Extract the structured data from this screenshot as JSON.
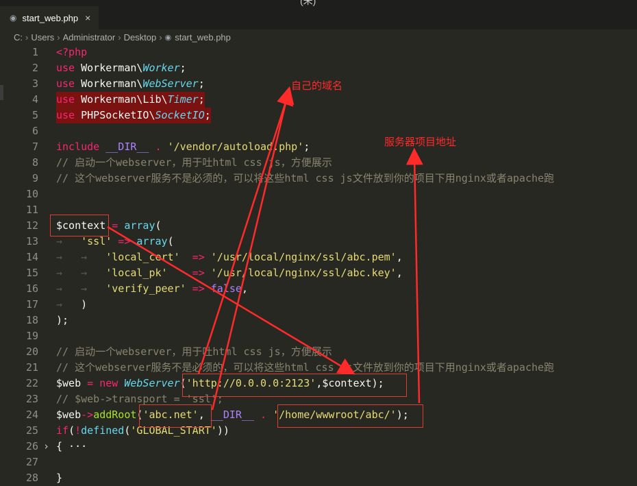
{
  "window": {
    "title_fragment": "(未)"
  },
  "tab": {
    "label": "start_web.php",
    "close": "×",
    "icon": "php-file-icon"
  },
  "breadcrumb": [
    "C:",
    "Users",
    "Administrator",
    "Desktop",
    "start_web.php"
  ],
  "annotations": {
    "domain_label": "自己的域名",
    "server_path_label": "服务器项目地址"
  },
  "code": {
    "l1": "<?php",
    "l2_kw": "use",
    "l2_ns": " Workerman\\",
    "l2_cls": "Worker",
    "l2_end": ";",
    "l3_kw": "use",
    "l3_ns": " Workerman\\",
    "l3_cls": "WebServer",
    "l3_end": ";",
    "l4_kw": "use",
    "l4_ns": " Workerman\\Lib\\",
    "l4_cls": "Timer",
    "l4_end": ";",
    "l5_kw": "use",
    "l5_ns": " PHPSocketIO\\",
    "l5_cls": "SocketIO",
    "l5_end": ";",
    "l7_kw": "include",
    "l7_const": " __DIR__",
    "l7_op": " . ",
    "l7_str": "'/vendor/autoload.php'",
    "l7_end": ";",
    "l8": "// 启动一个webserver，用于吐html css js，方便展示",
    "l9": "// 这个webserver服务不是必须的，可以将这些html css js文件放到你的项目下用nginx或者apache跑",
    "l12_var": "$context",
    "l12_op": " = ",
    "l12_fn": "array",
    "l12_end": "(",
    "l13_str": "'ssl'",
    "l13_op": " => ",
    "l13_fn": "array",
    "l13_end": "(",
    "l14_key": "'local_cert'",
    "l14_op": "  => ",
    "l14_val": "'/usr/local/nginx/ssl/abc.pem'",
    "l14_end": ",",
    "l15_key": "'local_pk'",
    "l15_op": "    => ",
    "l15_val": "'/usr/local/nginx/ssl/abc.key'",
    "l15_end": ",",
    "l16_key": "'verify_peer'",
    "l16_op": " => ",
    "l16_val": "false",
    "l16_end": ",",
    "l17": ")",
    "l18": ");",
    "l20": "// 启动一个webserver，用于吐html css js，方便展示",
    "l21": "// 这个webserver服务不是必须的，可以将这些html css js文件放到你的项目下用nginx或者apache跑",
    "l22_var": "$web",
    "l22_op": " = ",
    "l22_new": "new",
    "l22_cls": " WebServer",
    "l22_p1": "(",
    "l22_str": "'http://0.0.0.0:2123'",
    "l22_rest": ",$context);",
    "l23": "// $web->transport = 'ssl';",
    "l24_var": "$web",
    "l24_op": "->",
    "l24_fn": "addRoot",
    "l24_p": "(",
    "l24_str1": "'abc.net'",
    "l24_c": ", ",
    "l24_const": "__DIR__",
    "l24_dot": " . ",
    "l24_str2": "'/home/wwwroot/abc/'",
    "l24_end": ");",
    "l25_if": "if",
    "l25_p1": "(",
    "l25_not": "!",
    "l25_fn": "defined",
    "l25_p2": "(",
    "l25_str": "'GLOBAL_START'",
    "l25_end": "))",
    "l26": "{ ···",
    "l28": "}"
  },
  "line_numbers": [
    "1",
    "2",
    "3",
    "4",
    "5",
    "6",
    "7",
    "8",
    "9",
    "10",
    "11",
    "12",
    "13",
    "14",
    "15",
    "16",
    "17",
    "18",
    "19",
    "20",
    "21",
    "22",
    "23",
    "24",
    "25",
    "26",
    "27",
    "28"
  ]
}
